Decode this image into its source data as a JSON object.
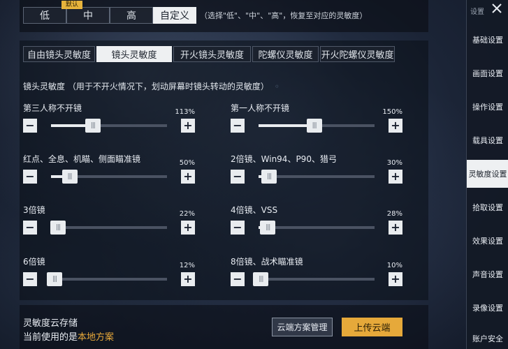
{
  "presets": {
    "low": "低",
    "mid": "中",
    "high": "高",
    "custom": "自定义",
    "default_tag": "默认",
    "hint": "（选择\"低\"、\"中\"、\"高\"，恢复至对应的灵敏度）"
  },
  "tabs": [
    {
      "label": "自由镜头灵敏度",
      "active": false
    },
    {
      "label": "镜头灵敏度",
      "active": true
    },
    {
      "label": "开火镜头灵敏度",
      "active": false
    },
    {
      "label": "陀螺仪灵敏度",
      "active": false
    },
    {
      "label": "开火陀螺仪灵敏度",
      "active": false
    }
  ],
  "section": {
    "title": "镜头灵敏度   （用于不开火情况下，划动屏幕时镜头转动的灵敏度）"
  },
  "sliders": [
    {
      "label": "第三人称不开镜",
      "value": "113%",
      "level": 0.36
    },
    {
      "label": "第一人称不开镜",
      "value": "150%",
      "level": 0.48
    },
    {
      "label": "红点、全息、机瞄、侧面瞄准镜",
      "value": "50%",
      "level": 0.16
    },
    {
      "label": "2倍镜、Win94、P90、猎弓",
      "value": "30%",
      "level": 0.09
    },
    {
      "label": "3倍镜",
      "value": "22%",
      "level": 0.06
    },
    {
      "label": "4倍镜、VSS",
      "value": "28%",
      "level": 0.08
    },
    {
      "label": "6倍镜",
      "value": "12%",
      "level": 0.03
    },
    {
      "label": "8倍镜、战术瞄准镜",
      "value": "10%",
      "level": 0.02
    }
  ],
  "cloud": {
    "title": "灵敏度云存储",
    "current_prefix": "当前使用的是",
    "current_plan": "本地方案",
    "manage_button": "云端方案管理",
    "upload_button": "上传云端"
  },
  "sidebar": {
    "top_label": "设置",
    "items": [
      {
        "label": "基础设置",
        "active": false
      },
      {
        "label": "画面设置",
        "active": false
      },
      {
        "label": "操作设置",
        "active": false
      },
      {
        "label": "载具设置",
        "active": false
      },
      {
        "label": "灵敏度设置",
        "active": true
      },
      {
        "label": "拾取设置",
        "active": false
      },
      {
        "label": "效果设置",
        "active": false
      },
      {
        "label": "声音设置",
        "active": false
      },
      {
        "label": "录像设置",
        "active": false
      },
      {
        "label": "账户安全",
        "active": false
      }
    ]
  },
  "colors": {
    "accent": "#e6a93a",
    "active_bg": "#eef0f2"
  }
}
